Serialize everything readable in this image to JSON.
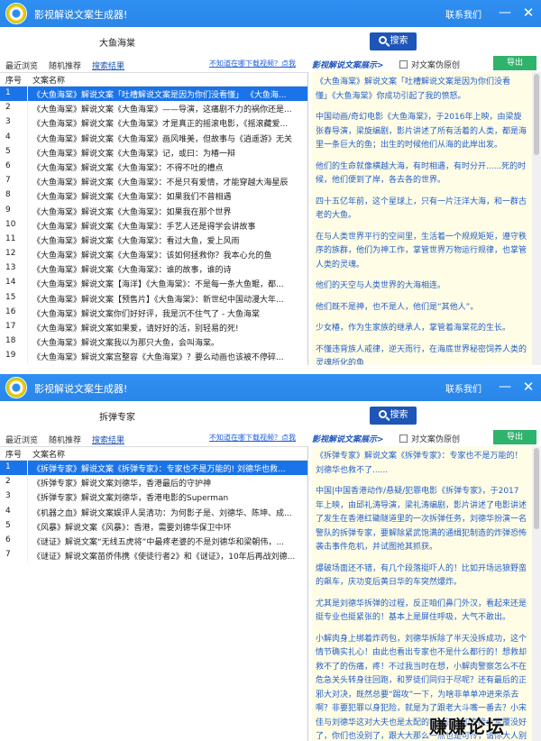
{
  "common": {
    "app_title": "影视解说文案生成器!",
    "contact": "联系我们",
    "minimize_glyph": "—",
    "close_glyph": "✕",
    "search_label": "搜索",
    "tabs": [
      "最近浏览",
      "随机推荐",
      "搜索结果"
    ],
    "hint": "不知道在哪下载视频？点我",
    "preview_title": "影视解说文案展示>",
    "checkbox_label": "对文案伪原创",
    "export_label": "导出",
    "col_index": "序号",
    "col_name": "文案名称",
    "accent": "#2d8cf0",
    "selection": "#1a73e8",
    "search_button": "#1e56b7",
    "export_button": "#2fb36c"
  },
  "windows": [
    {
      "search_value": "大鱼海棠",
      "rows": [
        {
          "index": "1",
          "name": "《大鱼海棠》解说文案「吐槽解说文案是因为你们没看懂」 《大鱼海..."
        },
        {
          "index": "2",
          "name": "《大鱼海棠》解说文案《大鱼海棠》——导演，这痛剧不力的祸你还是..."
        },
        {
          "index": "3",
          "name": "《大鱼海棠》解说文案《大鱼海棠》才是真正的摇滚电影，《摇滚藏爱..."
        },
        {
          "index": "4",
          "name": "《大鱼海棠》解说文案《大鱼海棠》画风唯美，但故事与《逍遥游》无关"
        },
        {
          "index": "5",
          "name": "《大鱼海棠》解说文案《大鱼海棠》记，或曰：为椿一辩"
        },
        {
          "index": "6",
          "name": "《大鱼海棠》解说文案《大鱼海棠》：不得不吐的槽点"
        },
        {
          "index": "7",
          "name": "《大鱼海棠》解说文案《大鱼海棠》：不是只有爱情，才能穿越大海星辰"
        },
        {
          "index": "8",
          "name": "《大鱼海棠》解说文案《大鱼海棠》：如果我们不曾相遇"
        },
        {
          "index": "9",
          "name": "《大鱼海棠》解说文案《大鱼海棠》：如果我在那个世界"
        },
        {
          "index": "10",
          "name": "《大鱼海棠》解说文案《大鱼海棠》：手艺人还是得学会讲故事"
        },
        {
          "index": "11",
          "name": "《大鱼海棠》解说文案《大鱼海棠》：看过大鱼，爱上风雨"
        },
        {
          "index": "12",
          "name": "《大鱼海棠》解说文案《大鱼海棠》：该如何拯救你？我本心允的鱼"
        },
        {
          "index": "13",
          "name": "《大鱼海棠》解说文案《大鱼海棠》：谁的故事，谁的诗"
        },
        {
          "index": "14",
          "name": "《大鱼海棠》解说文案【海洋】《大鱼海棠》：不是每一条大鱼鲲，都..."
        },
        {
          "index": "15",
          "name": "《大鱼海棠》解说文案【预售片】《大鱼海棠》：新世纪中国动漫大年..."
        },
        {
          "index": "16",
          "name": "《大鱼海棠》解说文案你们好好评，我是沉不住气了 - 大鱼海棠"
        },
        {
          "index": "17",
          "name": "《大鱼海棠》解说文案如果爱，请好好的活，别轻易的死!"
        },
        {
          "index": "18",
          "name": "《大鱼海棠》解说文案我以为那只大鱼，会叫海棠。"
        },
        {
          "index": "19",
          "name": "《大鱼海棠》解说文案宫整容《大鱼海棠》？要么动画也该被不停碎..."
        }
      ],
      "paragraphs": [
        "《大鱼海棠》解说文案「吐槽解说文案是因为你们没看懂」《大鱼海棠》你成功引起了我的愤怒。",
        "中国动画/奇幻电影《大鱼海棠》，于2016年上映，由梁旋张春导演，梁旋编剧，影片讲述了所有活着的人类，都是海里一条巨大的鱼；出生的时候他们从海的此岸出发。",
        "他们的生命就像横越大海，有时相遇，有时分开......死的时候，他们便到了岸，各去各的世界。",
        "四十五亿年前，这个星球上，只有一片汪洋大海，和一群古老的大鱼。",
        "在与人类世界平行的空间里，生活着一个规规矩矩，遵守秩序的族群，他们为神工作，掌管世界万物运行规律，也掌管人类的灵魂。",
        "他们的天空与人类世界的大海相连。",
        "他们既不是神，也不是人，他们是“其他人”。",
        "少女椿，作为生家族的继承人，掌管着海棠花的生长。",
        "不懂违背族人戒律，逆天而行，在海底世界秘密饲养人类的灵魂所化的鱼"
      ]
    },
    {
      "search_value": "拆弹专家",
      "rows": [
        {
          "index": "1",
          "name": "《拆弹专家》解说文案《拆弹专家》：专家也不是万能的! 刘德华也救..."
        },
        {
          "index": "2",
          "name": "《拆弹专家》解说文案刘德华，香港最后的守护神"
        },
        {
          "index": "3",
          "name": "《拆弹专家》解说文案刘德华，香港电影的Superman"
        },
        {
          "index": "4",
          "name": "《机器之血》解说文案娱评人吴清功：为何影子是、刘德华、陈坤、成..."
        },
        {
          "index": "5",
          "name": "《风暴》解说文案《风暴》：香港，需要刘德华保卫中环"
        },
        {
          "index": "6",
          "name": "《谜证》解说文案“无线五虎将”中最疼老婆的不是刘德华和梁朝伟，..."
        },
        {
          "index": "7",
          "name": "《谜证》解说文案苗侨伟携《使徒行者2》和《谜证》，10年后再战刘德..."
        }
      ],
      "paragraphs": [
        "《拆弹专家》解说文案《拆弹专家》：专家也不是万能的！刘德华也救不了......",
        "中国|中国香港动作/悬疑/犯罪电影《拆弹专家》，于2017年上映，由邱礼涛导演，梁礼涛编剧，影片讲述了电影讲述了发生在香港红磡隧道里的一次拆弹任务，刘德华扮演一名警队的拆弹专家，要解除紧武饱满的通缉犯制造的炸弹恐怖袭击事件危机，并试图抢其抓获。",
        "爆破场面还不错，有几个段落挺吓人的！比如开场远狼野蛮的飙车，庆功变后黄日华的车突然爆炸。",
        "尤其是刘德华拆弹的过程，反正咱们鼻门外汉，看起来还是挺专业也挺紧张的！基本上是屏住呼吸，大气不敢出。",
        "小解肉身上绑着炸药包，刘德华拆除了半天没拆成功，这个情节确实扎心！由此也看出专家也不是什么都行的！想救却救不了的伤痛，疼！不过我当时在想，小解肉警察怎么不在危急关头转身往回跑，和罗徒们同归于尽呢？还有最后的正邪大对决，既然总要“踢攻”一下，为啥非单单冲进来杀去啊？非要犯罪以身犯险，就是为了跟老大斗嘴一番去？小宋佳与刘德华这对大夫也是太配的啊！还不如直接全军覆没好了，你们也没别了，跟大大那么一点也是可怜，请你大人别扭！尤其是两人从相识到感人情侣，刚刚回到发生动画，设计感太过强烈，感觉就像电脑编程一样：这个地方必"
      ]
    }
  ],
  "watermark": "赚赚论坛"
}
